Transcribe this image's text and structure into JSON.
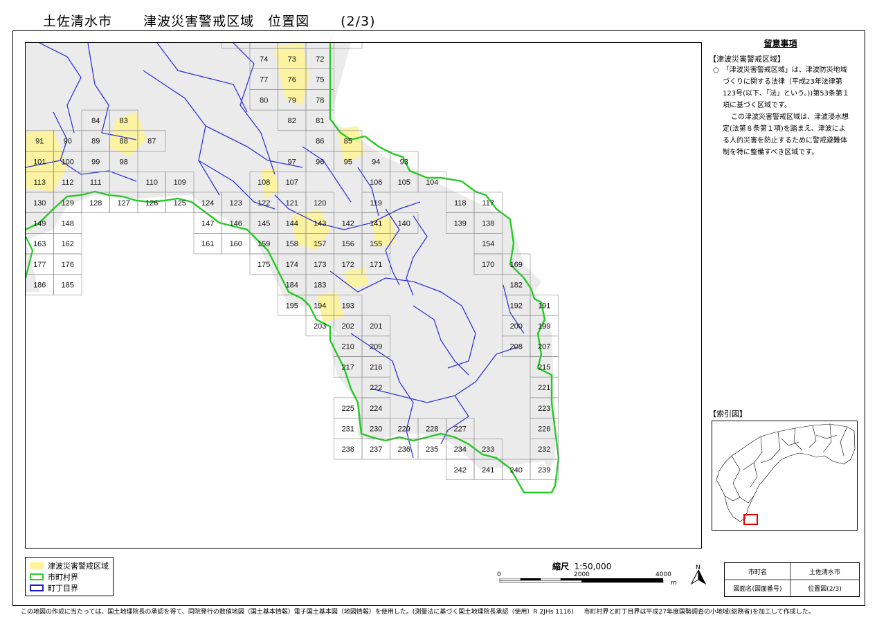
{
  "title": {
    "city": "土佐清水市",
    "subject": "津波災害警戒区域　位置図",
    "page": "(2/3)"
  },
  "notes": {
    "heading": "留意事項",
    "section": "【津波災害警戒区域】",
    "paragraph1": "○　「津波災害警戒区域」は、津波防災地域づくりに関する法律（平成23年法律第123号(以下、「法」という。))第53条第１項に基づく区域です。",
    "paragraph2": "この津波災害警戒区域は、津波浸水想定(法第８条第１項)を踏まえ、津波による人的災害を防止するために警戒避難体制を特に整備すべき区域です。"
  },
  "index_map": {
    "heading": "【索引図】"
  },
  "legend": {
    "items": [
      {
        "label": "津波災害警戒区域",
        "color": "#fdf39a",
        "style": "fill"
      },
      {
        "label": "市町村界",
        "color": "#2ecc2e",
        "style": "outline"
      },
      {
        "label": "町丁目界",
        "color": "#1a1acc",
        "style": "outline"
      }
    ]
  },
  "scale": {
    "title": "縮尺",
    "ratio": "1:50,000",
    "ticks": [
      "0",
      "2000",
      "4000"
    ],
    "unit": "m"
  },
  "north_label": "N",
  "info_table": {
    "row1_label": "市町名",
    "row1_value": "土佐清水市",
    "row2_label": "図面名(図面番号)",
    "row2_value": "位置図(2/3)"
  },
  "footer": {
    "left": "この地図の作成に当たっては、国土地理院長の承認を得て、同院発行の数値地図（国土基本情報）電子国土基本図（地図情報）を使用した。(測量法に基づく国土地理院長承認（使用）R 2JHs 1116)",
    "right": "市町村界と町丁目界は平成27年度国勢調査の小地域(総務省)を加工して作成した。"
  },
  "map": {
    "colors": {
      "hazard": "#fdf39a",
      "city_boundary": "#22cc22",
      "town_boundary": "#3333dd",
      "grid": "#888888",
      "land": "#ebebeb"
    },
    "sheets": [
      "74",
      "73",
      "72",
      "77",
      "76",
      "75",
      "80",
      "79",
      "78",
      "84",
      "83",
      "82",
      "81",
      "91",
      "90",
      "89",
      "88",
      "87",
      "86",
      "85",
      "101",
      "100",
      "99",
      "98",
      "97",
      "96",
      "95",
      "94",
      "93",
      "113",
      "112",
      "111",
      "110",
      "109",
      "108",
      "107",
      "106",
      "105",
      "104",
      "130",
      "129",
      "128",
      "127",
      "126",
      "125",
      "124",
      "123",
      "122",
      "121",
      "120",
      "119",
      "118",
      "117",
      "149",
      "148",
      "147",
      "146",
      "145",
      "144",
      "143",
      "142",
      "141",
      "140",
      "139",
      "138",
      "163",
      "162",
      "161",
      "160",
      "159",
      "158",
      "157",
      "156",
      "155",
      "154",
      "177",
      "176",
      "175",
      "174",
      "173",
      "172",
      "171",
      "170",
      "169",
      "186",
      "185",
      "184",
      "183",
      "182",
      "195",
      "194",
      "193",
      "192",
      "191",
      "203",
      "202",
      "201",
      "200",
      "199",
      "210",
      "209",
      "208",
      "207",
      "217",
      "216",
      "215",
      "222",
      "221",
      "225",
      "224",
      "223",
      "231",
      "230",
      "229",
      "228",
      "227",
      "226",
      "238",
      "237",
      "236",
      "235",
      "234",
      "233",
      "232",
      "242",
      "241",
      "240",
      "239"
    ]
  }
}
